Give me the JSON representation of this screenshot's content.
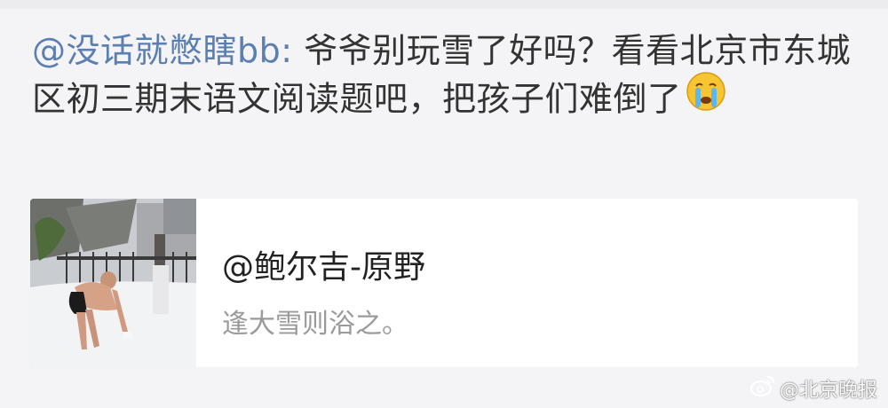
{
  "post": {
    "mention": "@没话就憋瞎bb:",
    "text": " 爷爷别玩雪了好吗？看看北京市东城区初三期末语文阅读题吧，把孩子们难倒了",
    "emoji": "crying-face"
  },
  "card": {
    "username": "@鲍尔吉-原野",
    "subtitle": "逢大雪则浴之。",
    "thumbnail": "man-bathing-in-snow"
  },
  "watermark": {
    "text": "@北京晚报",
    "icon": "weibo-logo"
  },
  "colors": {
    "mention": "#5a7fb0",
    "background": "#f4f4f6",
    "card": "#ffffff"
  }
}
